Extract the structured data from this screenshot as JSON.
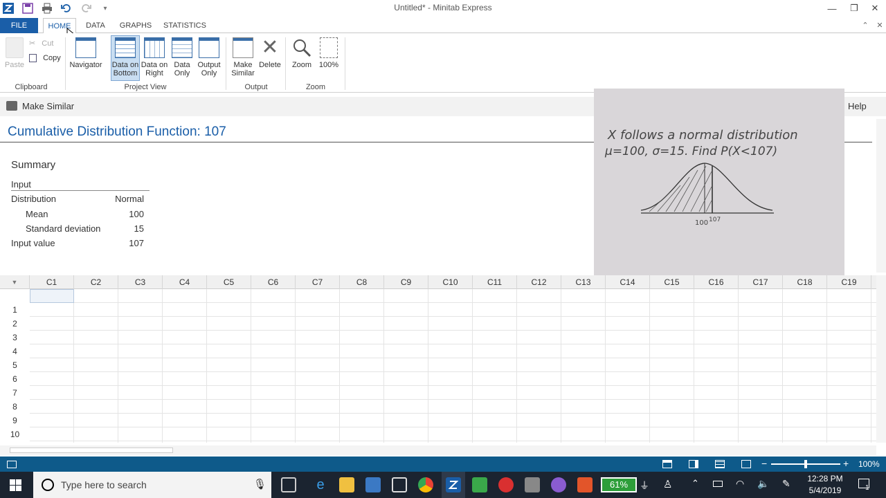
{
  "window": {
    "title": "Untitled* - Minitab Express"
  },
  "tabs": [
    {
      "label": "FILE"
    },
    {
      "label": "HOME"
    },
    {
      "label": "DATA"
    },
    {
      "label": "GRAPHS"
    },
    {
      "label": "STATISTICS"
    }
  ],
  "ribbon": {
    "clipboard": {
      "paste": "Paste",
      "cut": "Cut",
      "copy": "Copy",
      "group": "Clipboard"
    },
    "navigator": "Navigator",
    "project_view": {
      "data_on_bottom": [
        "Data on",
        "Bottom"
      ],
      "data_on_right": [
        "Data on",
        "Right"
      ],
      "data_only": [
        "Data",
        "Only"
      ],
      "output_only": [
        "Output",
        "Only"
      ],
      "group": "Project View"
    },
    "output": {
      "make_similar": [
        "Make",
        "Similar"
      ],
      "delete": "Delete",
      "group": "Output"
    },
    "zoom": {
      "zoom": "Zoom",
      "hundred": "100%",
      "group": "Zoom"
    }
  },
  "subheader": {
    "make_similar": "Make Similar",
    "help": "Help"
  },
  "output": {
    "title": "Cumulative Distribution Function: 107",
    "summary_heading": "Summary",
    "input_heading": "Input",
    "rows": [
      {
        "label": "Distribution",
        "value": "Normal"
      },
      {
        "label": "Mean",
        "value": "100"
      },
      {
        "label": "Standard deviation",
        "value": "15"
      },
      {
        "label": "Input value",
        "value": "107"
      }
    ]
  },
  "webcam": {
    "line1": "X follows a normal distribution",
    "line2": "μ=100,  σ=15. Find P(X<107)",
    "mean_label": "100",
    "x_label": "107"
  },
  "sheet": {
    "columns": [
      "C1",
      "C2",
      "C3",
      "C4",
      "C5",
      "C6",
      "C7",
      "C8",
      "C9",
      "C10",
      "C11",
      "C12",
      "C13",
      "C14",
      "C15",
      "C16",
      "C17",
      "C18",
      "C19"
    ],
    "rows": [
      "1",
      "2",
      "3",
      "4",
      "5",
      "6",
      "7",
      "8",
      "9",
      "10"
    ]
  },
  "statusbar": {
    "zoom": "100%"
  },
  "taskbar": {
    "search_placeholder": "Type here to search",
    "battery": "61%",
    "time": "12:28 PM",
    "date": "5/4/2019",
    "notifications": "1"
  },
  "colors": {
    "accent": "#1a5ea8",
    "status": "#0e5a8a",
    "taskbar": "#1b2430"
  }
}
